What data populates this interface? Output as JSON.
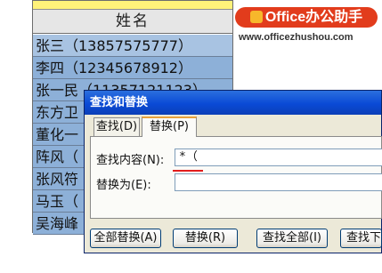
{
  "sheet": {
    "header": "姓名",
    "rows": [
      "张三（13857575777）",
      "李四（12345678912）",
      "张一民（11357121123）",
      "东方卫",
      "董化一",
      "阵风（",
      "张风符",
      "马玉（",
      "吴海峰"
    ]
  },
  "watermark": {
    "logo_text": "Office办公助手",
    "url": "www.officezhushou.com"
  },
  "dialog": {
    "title": "查找和替换",
    "tabs": {
      "find": "查找(D)",
      "replace": "替换(P)"
    },
    "find_label": "查找内容(N):",
    "find_value": "*（",
    "replace_label": "替换为(E):",
    "replace_value": "",
    "buttons": {
      "replace_all": "全部替换(A)",
      "replace": "替换(R)",
      "find_all": "查找全部(I)",
      "find_next": "查找下一个(F)"
    }
  },
  "colors": {
    "titlebar": "#0a4ad6",
    "cell_fill": "#8db0d8",
    "highlight": "#e21d1d",
    "logo": "#e23c1c"
  }
}
